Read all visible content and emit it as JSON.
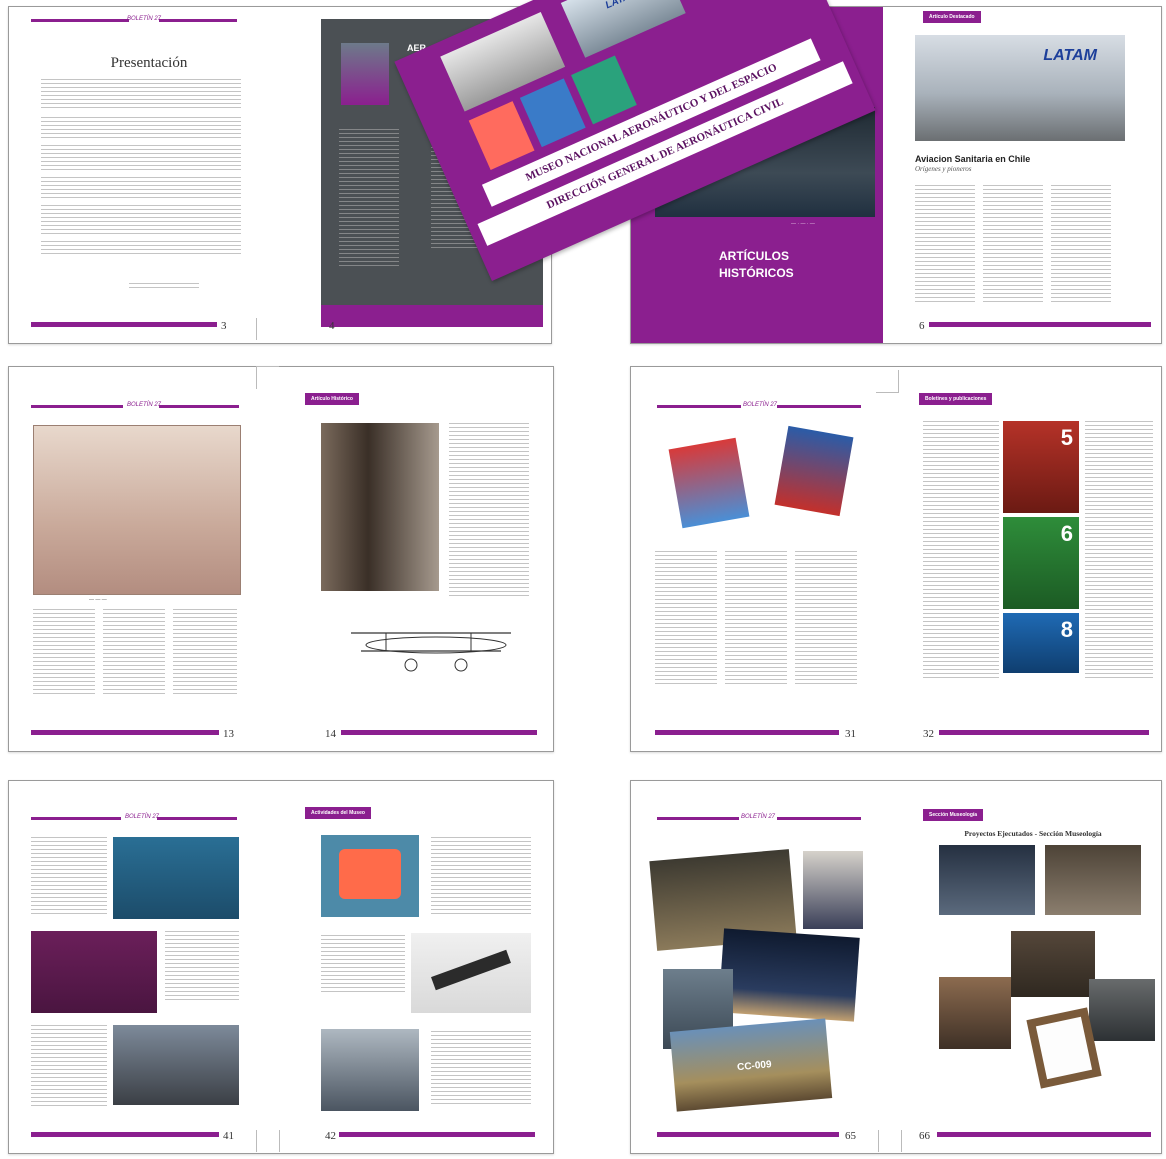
{
  "colors": {
    "accent": "#8b1f8f",
    "dark_panel": "#4b5054"
  },
  "spread1": {
    "header_logo": "BOLETÍN 27",
    "title": "Presentación",
    "page_left": "3",
    "page_right": "4",
    "panel_header": "AER"
  },
  "cover": {
    "line1": "MUSEO NACIONAL AERONÁUTICO Y DEL ESPACIO",
    "line2": "DIRECCIÓN GENERAL DE AERONÁUTICA CIVIL",
    "latam": "LATAM"
  },
  "spread2": {
    "section_title_line1": "ARTÍCULOS",
    "section_title_line2": "HISTÓRICOS",
    "tag": "Artículo Destacado",
    "article_title": "Aviacion Sanitaria en Chile",
    "article_subtitle": "Orígenes y pioneros",
    "latam": "LATAM",
    "page_right": "6"
  },
  "spread3": {
    "header_logo": "BOLETÍN 27",
    "tag": "Artículo Histórico",
    "page_left": "13",
    "page_right": "14"
  },
  "spread4": {
    "header_logo": "BOLETÍN 27",
    "tag": "Boletines y publicaciones",
    "page_left": "31",
    "page_right": "32",
    "numbers": [
      "5",
      "6",
      "8"
    ]
  },
  "spread5": {
    "header_logo": "BOLETÍN 27",
    "tag": "Actividades del Museo",
    "page_left": "41",
    "page_right": "42"
  },
  "spread6": {
    "header_logo": "BOLETÍN 27",
    "tag": "Sección Museología",
    "title": "Proyectos Ejecutados - Sección Museología",
    "page_left": "65",
    "page_right": "66",
    "plane_code": "CC-009"
  }
}
